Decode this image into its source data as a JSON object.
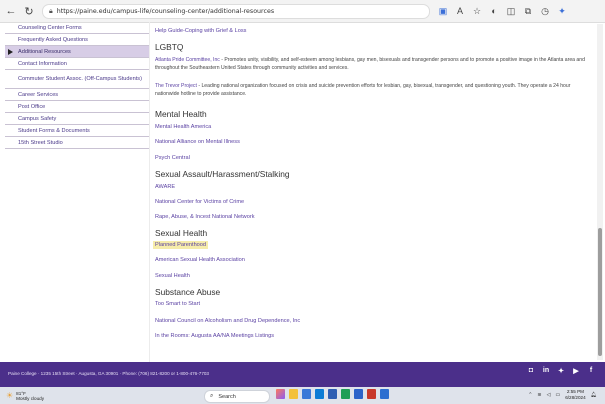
{
  "browser": {
    "url": "https://paine.edu/campus-life/counseling-center/additional-resources",
    "toolbar_icons": [
      "extensions-icon",
      "zoom-icon",
      "favorite-icon",
      "reading-icon",
      "split-icon",
      "collections-icon",
      "history-icon",
      "copilot-icon"
    ]
  },
  "sidebar": {
    "items": [
      {
        "label": "Counseling Center Forms"
      },
      {
        "label": "Frequently Asked Questions"
      },
      {
        "label": "Additional Resources",
        "active": true
      },
      {
        "label": "Contact Information"
      },
      {
        "label": "Commuter Student Assoc. (Off-Campus Students)"
      },
      {
        "label": "Career Services"
      },
      {
        "label": "Post Office"
      },
      {
        "label": "Campus Safety"
      },
      {
        "label": "Student Forms & Documents"
      },
      {
        "label": "15th Street Studio"
      }
    ]
  },
  "content": {
    "grief_link": "Help Guide-Coping with Grief & Loss",
    "lgbtq": {
      "heading": "LGBTQ",
      "atlanta_link": "Atlanta Pride Committee, Inc",
      "atlanta_text": " - Promotes unity, visibility, and self-esteem among lesbians, gay men, bisexuals and transgender persons and to promote a positive image in the Atlanta area and throughout the Southeastern United States through community activities and services.",
      "trevor_link": "The Trevor Project",
      "trevor_text": "- Leading national organization focused on crisis and suicide prevention efforts for lesbian, gay, bisexual, transgender, and questioning youth. They operate a 24 hour nationwide hotline to provide assistance."
    },
    "mental_health": {
      "heading": "Mental Health",
      "links": [
        "Mental Health America",
        "National Alliance on Mental Illness",
        "Psych Central"
      ]
    },
    "sexual_assault": {
      "heading": "Sexual Assault/Harassment/Stalking",
      "links": [
        "AWARE",
        "National Center for Victims of Crime",
        "Rape, Abuse, & Incest National Network"
      ]
    },
    "sexual_health": {
      "heading": "Sexual Health",
      "links": [
        "Planned Parenthood",
        "American Sexual Health Association",
        "Sexual Health"
      ]
    },
    "substance_abuse": {
      "heading": "Substance Abuse",
      "links": [
        "Too Smart to Start",
        "National Council on Alcoholism and Drug Dependence, Inc",
        "In the Rooms: Augusta AA/NA Meetings Listings"
      ]
    }
  },
  "footer": {
    "text": "Paine College · 1235 15th Street · Augusta, GA 30901 · Phone: (706) 821-8200 or 1-800-476-7703",
    "social": [
      "instagram-icon",
      "linkedin-icon",
      "twitter-icon",
      "youtube-icon",
      "facebook-icon"
    ],
    "color": "#4b2f8a"
  },
  "taskbar": {
    "weather_temp": "81°F",
    "weather_desc": "Mostly cloudy",
    "search_placeholder": "Search",
    "time": "2:55 PM",
    "date": "6/28/2024"
  }
}
